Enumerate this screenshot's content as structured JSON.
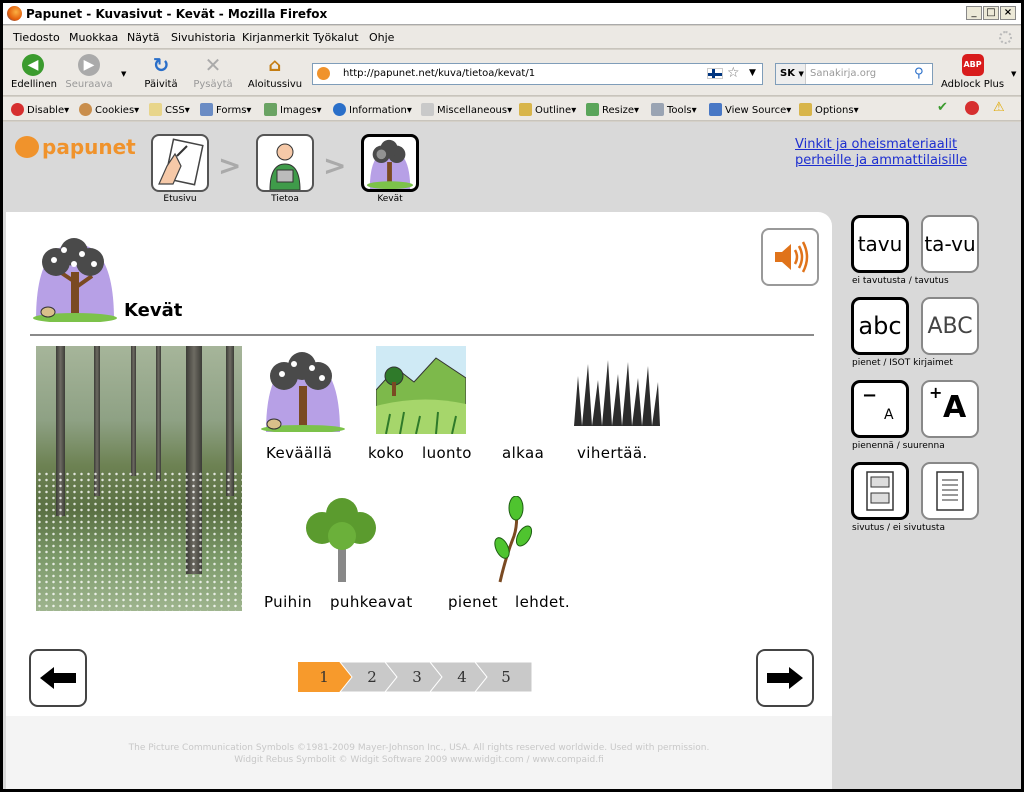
{
  "window": {
    "title": "Papunet - Kuvasivut - Kevät - Mozilla Firefox"
  },
  "menu": [
    "Tiedosto",
    "Muokkaa",
    "Näytä",
    "Sivuhistoria",
    "Kirjanmerkit",
    "Työkalut",
    "Ohje"
  ],
  "nav": {
    "back": "Edellinen",
    "forward": "Seuraava",
    "reload": "Päivitä",
    "stop": "Pysäytä",
    "home": "Aloitussivu",
    "url": "http://papunet.net/kuva/tietoa/kevat/1",
    "search_engine": "SK",
    "search_placeholder": "Sanakirja.org",
    "adblock": "Adblock Plus",
    "adblock_icon_text": "ABP"
  },
  "devbar": [
    "Disable",
    "Cookies",
    "CSS",
    "Forms",
    "Images",
    "Information",
    "Miscellaneous",
    "Outline",
    "Resize",
    "Tools",
    "View Source",
    "Options"
  ],
  "site": {
    "logo": "papunet",
    "breadcrumbs": [
      "Etusivu",
      "Tietoa",
      "Kevät"
    ],
    "top_link_1": "Vinkit ja oheismateriaalit",
    "top_link_2": "perheille ja ammattilaisille",
    "heading": "Kevät",
    "sentence1": [
      "Keväällä",
      "koko",
      "luonto",
      "alkaa",
      "vihertää."
    ],
    "sentence2": [
      "Puihin",
      "puhkeavat",
      "pienet",
      "lehdet."
    ],
    "pages": [
      "1",
      "2",
      "3",
      "4",
      "5"
    ],
    "current_page": "1",
    "credit_1": "The Picture Communication Symbols ©1981-2009 Mayer-Johnson Inc., USA. All rights reserved worldwide. Used with permission.",
    "credit_2": "Widgit Rebus Symbolit © Widgit Software 2009 www.widgit.com / www.compaid.fi"
  },
  "tools": {
    "tavu": "tavu",
    "ta_vu": "ta-vu",
    "cap1": "ei tavutusta / tavutus",
    "abc": "abc",
    "ABC": "ABC",
    "cap2": "pienet / ISOT kirjaimet",
    "minus_a": "A",
    "plus_a": "A",
    "cap3": "pienennä / suurenna",
    "cap4": "sivutus / ei sivutusta"
  },
  "colors": {
    "accent": "#f0932c",
    "link": "#1d2ed0",
    "page_active": "#f79a2c",
    "page_inactive": "#c9c9c9"
  }
}
